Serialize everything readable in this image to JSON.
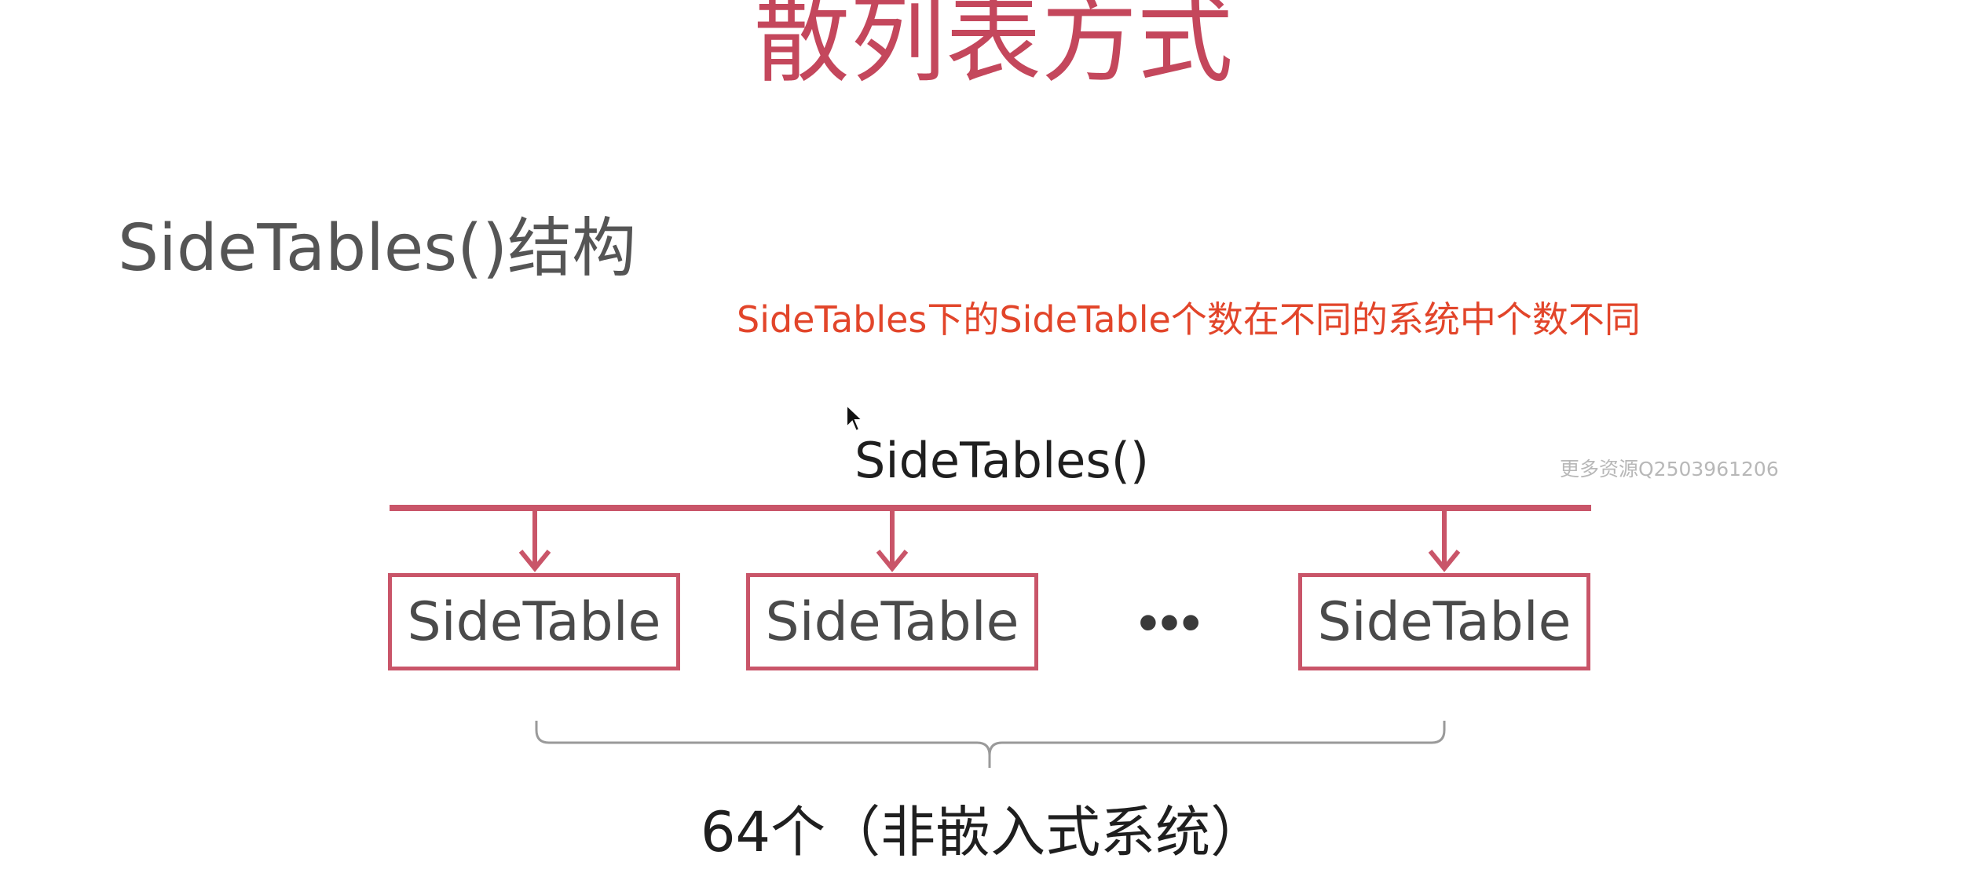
{
  "slide": {
    "title": "散列表方式",
    "section_heading": "SideTables()结构",
    "note": "SideTables下的SideTable个数在不同的系统中个数不同"
  },
  "diagram": {
    "root_label": "SideTables()",
    "tables": [
      {
        "label": "SideTable"
      },
      {
        "label": "SideTable"
      },
      {
        "label": "SideTable"
      }
    ],
    "ellipsis": "•••",
    "count_label": "64个（非嵌入式系统）"
  },
  "watermark": "更多资源Q2503961206",
  "colors": {
    "title": "#c4475c",
    "accent_line": "#c95569",
    "note": "#e2452a",
    "brace": "#9a9a9a"
  },
  "icons": {
    "cursor": "mouse-pointer-icon"
  }
}
